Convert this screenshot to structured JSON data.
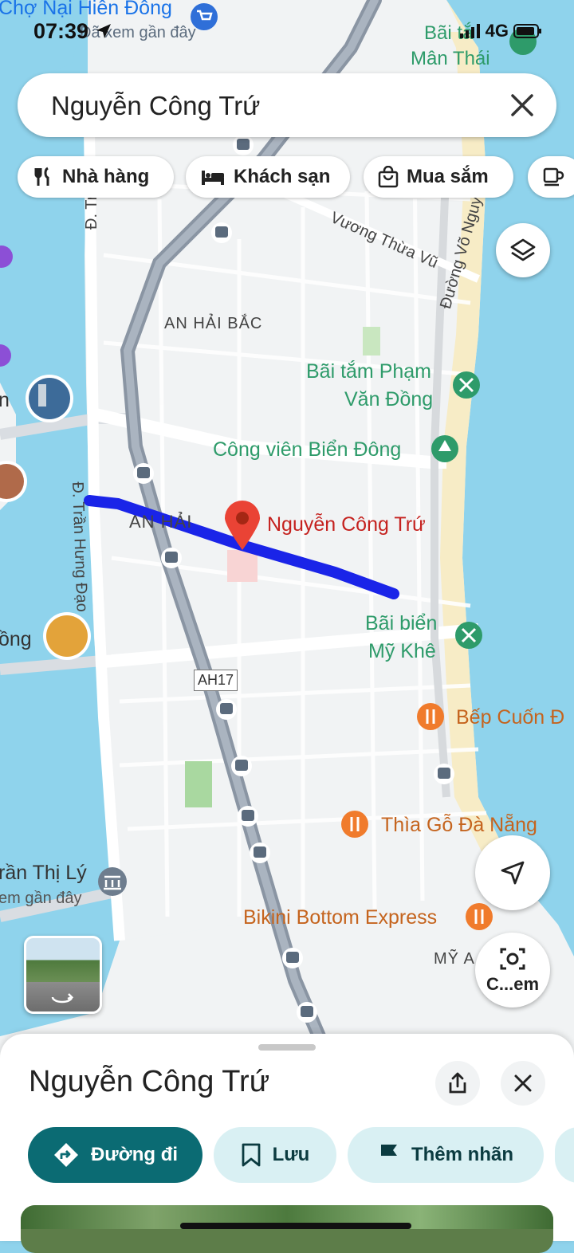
{
  "status": {
    "time": "07:39",
    "network": "4G"
  },
  "search": {
    "query": "Nguyễn Công Trứ"
  },
  "chips": [
    {
      "label": "Nhà hàng",
      "icon": "restaurant-icon"
    },
    {
      "label": "Khách sạn",
      "icon": "hotel-icon"
    },
    {
      "label": "Mua sắm",
      "icon": "shopping-bag-icon"
    },
    {
      "label": "",
      "icon": "coffee-icon"
    }
  ],
  "map": {
    "districts": {
      "an_hai_bac": "AN HẢI BẮC",
      "an_hai": "AN HẢI",
      "my_an": "MỸ A"
    },
    "streets": {
      "vuong_thua_vu": "Vương Thừa Vũ",
      "vo_nguyen": "Đường Võ Nguy",
      "tran_hung_dao": "Đ. Trần Hưng Đạo",
      "d_tr": "Đ. Tr"
    },
    "road_shield": "AH17",
    "pin_label": "Nguyễn Công Trứ",
    "places": {
      "cho_nai": "Chợ Nại Hiên Đông",
      "cho_nai_sub": "Đã xem gần đây",
      "bai_tam_man_thai_1": "Bãi tắ",
      "bai_tam_man_thai_2": "Mân Thái",
      "bai_tam_pham_1": "Bãi tắm Phạm",
      "bai_tam_pham_2": "Văn Đồng",
      "cong_vien": "Công viên Biển Đông",
      "bai_bien_1": "Bãi biển",
      "bai_bien_2": "Mỹ Khê",
      "bep_cuon": "Bếp Cuốn Đ",
      "thia_go": "Thìa Gỗ Đà Nẵng",
      "bikini": "Bikini Bottom Express",
      "tran_thi_ly": "rần Thị Lý",
      "tran_thi_ly_sub": "em gần đây",
      "left_n": "n",
      "left_ong": "ồng"
    },
    "colors": {
      "water": "#8fd3ec",
      "land": "#f1f3f4",
      "route": "#1a24e8",
      "green_icon": "#2e9b6a",
      "orange_icon": "#f07b2c"
    }
  },
  "buttons": {
    "camera_label": "C...em"
  },
  "sheet": {
    "title": "Nguyễn Công Trứ",
    "directions_label": "Đường đi",
    "save_label": "Lưu",
    "tag_label": "Thêm nhãn"
  }
}
